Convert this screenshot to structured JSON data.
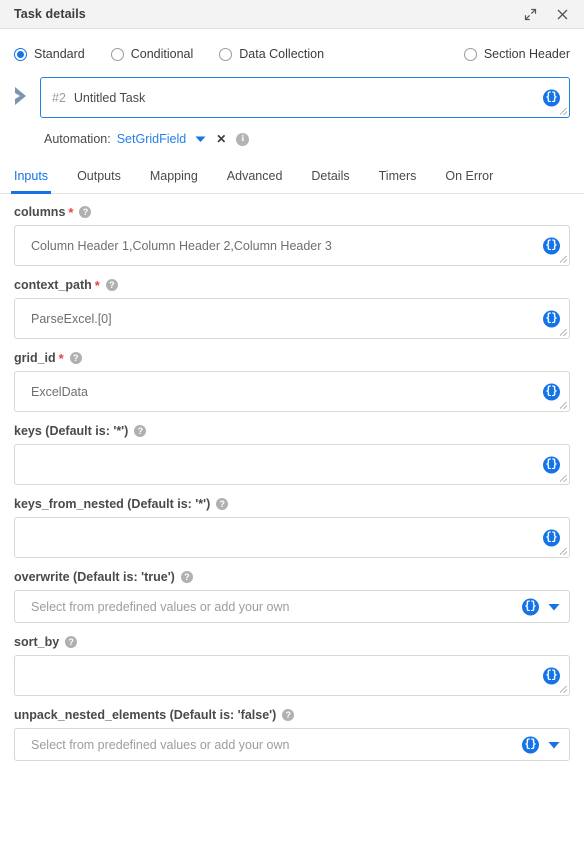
{
  "window": {
    "title": "Task details",
    "expand_icon": "expand-icon",
    "close_icon": "close-icon"
  },
  "task_type": {
    "options": [
      {
        "label": "Standard",
        "selected": true
      },
      {
        "label": "Conditional",
        "selected": false
      },
      {
        "label": "Data Collection",
        "selected": false
      },
      {
        "label": "Section Header",
        "selected": false
      }
    ]
  },
  "task": {
    "number": "#2",
    "name": "Untitled Task",
    "token_icon": "curly-braces-icon",
    "arrow_icon": "chevron-right-icon"
  },
  "automation": {
    "label": "Automation:",
    "value": "SetGridField",
    "caret_icon": "chevron-down-icon",
    "clear_icon": "close-icon",
    "info_icon": "info-icon"
  },
  "tabs": [
    {
      "label": "Inputs",
      "active": true
    },
    {
      "label": "Outputs",
      "active": false
    },
    {
      "label": "Mapping",
      "active": false
    },
    {
      "label": "Advanced",
      "active": false
    },
    {
      "label": "Details",
      "active": false
    },
    {
      "label": "Timers",
      "active": false
    },
    {
      "label": "On Error",
      "active": false
    }
  ],
  "fields": [
    {
      "name": "columns",
      "label": "columns",
      "required": true,
      "type": "textarea",
      "value": "Column Header 1,Column Header 2,Column Header 3",
      "placeholder": ""
    },
    {
      "name": "context_path",
      "label": "context_path",
      "required": true,
      "type": "textarea",
      "value": "ParseExcel.[0]",
      "placeholder": ""
    },
    {
      "name": "grid_id",
      "label": "grid_id",
      "required": true,
      "type": "textarea",
      "value": "ExcelData",
      "placeholder": ""
    },
    {
      "name": "keys",
      "label": "keys (Default is: '*')",
      "required": false,
      "type": "textarea",
      "value": "",
      "placeholder": ""
    },
    {
      "name": "keys_from_nested",
      "label": "keys_from_nested (Default is: '*')",
      "required": false,
      "type": "textarea",
      "value": "",
      "placeholder": ""
    },
    {
      "name": "overwrite",
      "label": "overwrite (Default is: 'true')",
      "required": false,
      "type": "select",
      "value": "",
      "placeholder": "Select from predefined values or add your own"
    },
    {
      "name": "sort_by",
      "label": "sort_by",
      "required": false,
      "type": "textarea",
      "value": "",
      "placeholder": ""
    },
    {
      "name": "unpack_nested_elements",
      "label": "unpack_nested_elements (Default is: 'false')",
      "required": false,
      "type": "select",
      "value": "",
      "placeholder": "Select from predefined values or add your own"
    }
  ],
  "icons": {
    "curly": "{}",
    "help": "?",
    "info": "i",
    "close": "✕"
  },
  "colors": {
    "accent": "#1473e6",
    "link": "#2680eb",
    "required": "#e8443a",
    "titlebar_bg": "#f3f3f3",
    "border": "#d8d8d8",
    "text": "#4a4a4a",
    "muted": "#9d9d9d"
  }
}
